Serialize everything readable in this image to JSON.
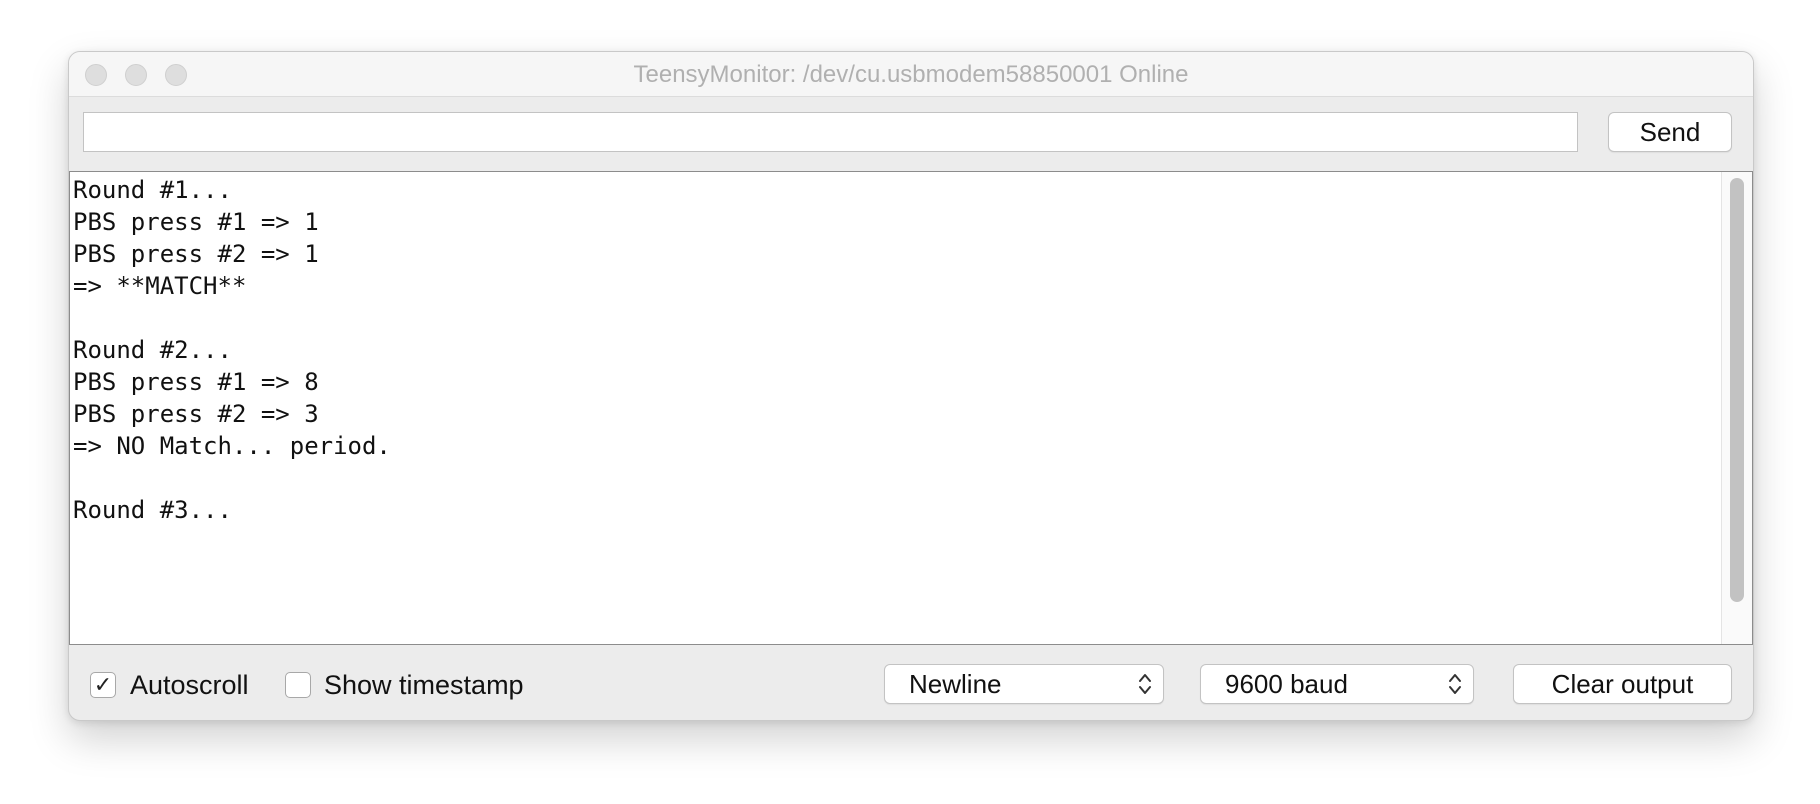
{
  "window": {
    "title": "TeensyMonitor: /dev/cu.usbmodem58850001 Online"
  },
  "toolbar": {
    "input_value": "",
    "send_label": "Send"
  },
  "output": {
    "lines": [
      "Round #1...",
      "PBS press #1 => 1",
      "PBS press #2 => 1",
      "=> **MATCH**",
      "",
      "Round #2...",
      "PBS press #1 => 8",
      "PBS press #2 => 3",
      "=> NO Match... period.",
      "",
      "Round #3..."
    ]
  },
  "footer": {
    "autoscroll_label": "Autoscroll",
    "autoscroll_checked": true,
    "timestamp_label": "Show timestamp",
    "timestamp_checked": false,
    "line_ending_value": "Newline",
    "baud_value": "9600 baud",
    "clear_label": "Clear output"
  },
  "icons": {
    "traffic_lights": [
      "close-icon",
      "minimize-icon",
      "zoom-icon"
    ],
    "check": "checkmark-icon",
    "select": "chevron-up-down-icon"
  },
  "colors": {
    "window_bg": "#ececec",
    "title_text": "#b0b0b0",
    "traffic_light_inactive": "#dedede",
    "output_bg": "#ffffff",
    "scroll_thumb": "#c2c2c2"
  }
}
